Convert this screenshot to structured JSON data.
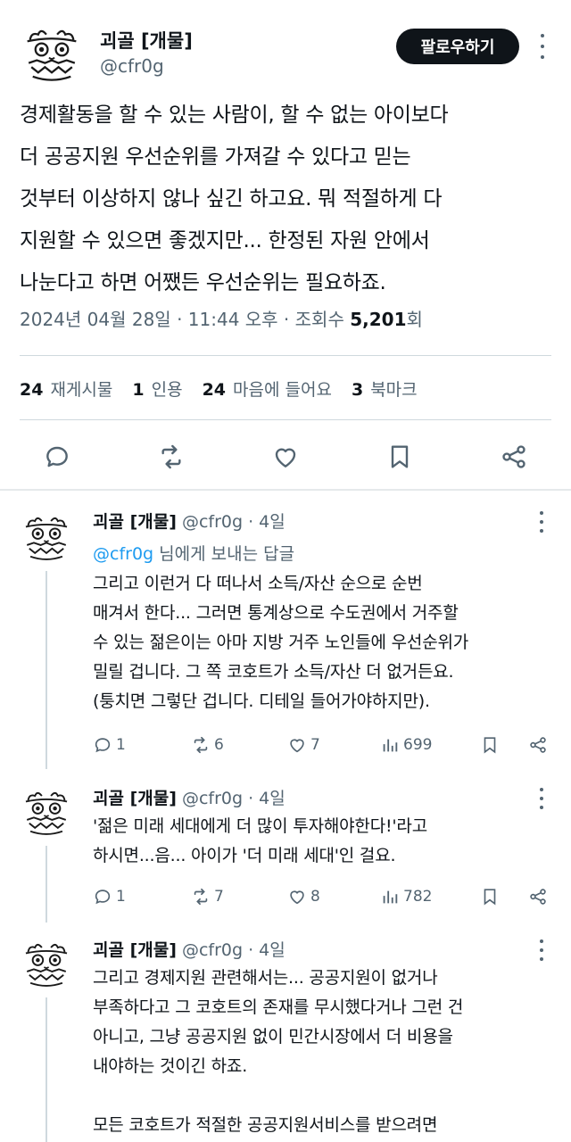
{
  "tweet": {
    "name": "괴골 [개물]",
    "handle": "@cfr0g",
    "follow_label": "팔로우하기",
    "text": "경제활동을 할 수 있는 사람이, 할 수 없는 아이보다\n더 공공지원 우선순위를 가져갈 수 있다고 믿는\n것부터 이상하지 않나 싶긴 하고요. 뭐 적절하게 다\n지원할 수 있으면 좋겠지만... 한정된 자원 안에서\n나눈다고 하면 어쨌든 우선순위는 필요하죠.",
    "timestamp": "2024년 04월 28일 · 11:44 오후 · 조회수 ",
    "views": "5,201",
    "views_suffix": "회",
    "stats": {
      "retweets": {
        "count": "24",
        "label": "재게시물"
      },
      "quotes": {
        "count": "1",
        "label": "인용"
      },
      "likes": {
        "count": "24",
        "label": "마음에 들어요"
      },
      "bookmarks": {
        "count": "3",
        "label": "북마크"
      }
    }
  },
  "replies": [
    {
      "name": "괴골 [개물]",
      "meta": " @cfr0g · 4일",
      "reply_to_mention": "@cfr0g",
      "reply_to_suffix": " 님에게 보내는 답글",
      "text": "그리고 이런거 다 떠나서 소득/자산 순으로 순번\n매겨서 한다... 그러면 통계상으로 수도권에서 거주할\n수 있는 젊은이는 아마 지방 거주 노인들에 우선순위가\n밀릴 겁니다. 그 쪽 코호트가 소득/자산 더 없거든요.\n(퉁치면 그렇단 겁니다. 디테일 들어가야하지만).",
      "replies": "1",
      "retweets": "6",
      "likes": "7",
      "views": "699"
    },
    {
      "name": "괴골 [개물]",
      "meta": " @cfr0g · 4일",
      "text": "'젊은 미래 세대에게 더 많이 투자해야한다!'라고\n하시면...음... 아이가 '더 미래 세대'인 걸요.",
      "replies": "1",
      "retweets": "7",
      "likes": "8",
      "views": "782"
    },
    {
      "name": "괴골 [개물]",
      "meta": " @cfr0g · 4일",
      "text": "그리고 경제지원 관련해서는... 공공지원이 없거나\n부족하다고 그 코호트의 존재를 무시했다거나 그런 건\n아니고, 그냥 공공지원 없이 민간시장에서 더 비용을\n내야하는 것이긴 하죠.\n\n모든 코호트가 적절한 공공지원서비스를 받으려면"
    }
  ],
  "colors": {
    "text": "#0f1419",
    "secondary": "#536471",
    "link": "#1d9bf0",
    "divider": "#cfd9de"
  },
  "icons": [
    "reply-icon",
    "retweet-icon",
    "like-icon",
    "bookmark-icon",
    "share-icon",
    "views-icon",
    "more-icon"
  ]
}
